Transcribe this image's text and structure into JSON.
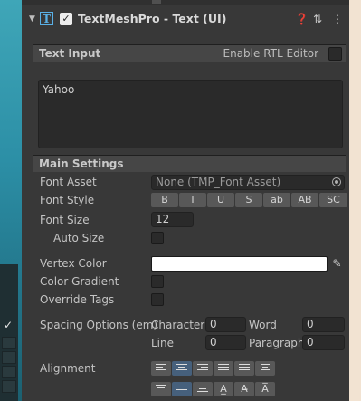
{
  "component": {
    "title": "TextMeshPro - Text (UI)",
    "icon": "tmp-text-icon",
    "enabled": true,
    "header_icons": [
      "help-icon",
      "preset-icon",
      "more-vert-icon"
    ]
  },
  "text_input": {
    "section_label": "Text Input",
    "rtl_label": "Enable RTL Editor",
    "rtl_enabled": false,
    "value": "Yahoo"
  },
  "main_settings": {
    "section_label": "Main Settings",
    "font_asset": {
      "label": "Font Asset",
      "value": "None (TMP_Font Asset)"
    },
    "font_style": {
      "label": "Font Style",
      "buttons": [
        "B",
        "I",
        "U",
        "S",
        "ab",
        "AB",
        "SC"
      ]
    },
    "font_size": {
      "label": "Font Size",
      "value": "12"
    },
    "auto_size": {
      "label": "Auto Size",
      "checked": false
    },
    "vertex_color": {
      "label": "Vertex Color",
      "value": "#ffffff"
    },
    "color_gradient": {
      "label": "Color Gradient",
      "checked": false
    },
    "override_tags": {
      "label": "Override Tags",
      "checked": false
    },
    "spacing": {
      "label": "Spacing Options (em)",
      "character_label": "Character",
      "character_value": "0",
      "word_label": "Word",
      "word_value": "0",
      "line_label": "Line",
      "line_value": "0",
      "paragraph_label": "Paragraph",
      "paragraph_value": "0"
    },
    "alignment": {
      "label": "Alignment",
      "horizontal": [
        "left",
        "center",
        "right",
        "justified",
        "flush",
        "geometry-center"
      ],
      "horizontal_selected": "center",
      "vertical": [
        "top",
        "middle",
        "bottom",
        "baseline",
        "midline",
        "capline"
      ],
      "vertical_selected": "middle"
    }
  }
}
